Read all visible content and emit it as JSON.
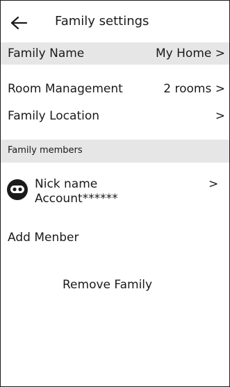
{
  "header": {
    "title": "Family settings",
    "back_icon": "arrow-left-icon"
  },
  "settings": {
    "family_name": {
      "label": "Family Name",
      "value": "My Home >"
    },
    "room_management": {
      "label": "Room Management",
      "value": "2 rooms >"
    },
    "family_location": {
      "label": "Family Location",
      "value": ">"
    }
  },
  "members_section": {
    "title": "Family members",
    "members": [
      {
        "name": "Nick name",
        "account": "Account******",
        "chevron": ">",
        "avatar_icon": "robot-face-avatar-icon"
      }
    ]
  },
  "actions": {
    "add_member": "Add Menber",
    "remove_family": "Remove Family"
  },
  "colors": {
    "shaded_row": "#e6e6e6",
    "text": "#1a1a1a",
    "background": "#ffffff"
  }
}
